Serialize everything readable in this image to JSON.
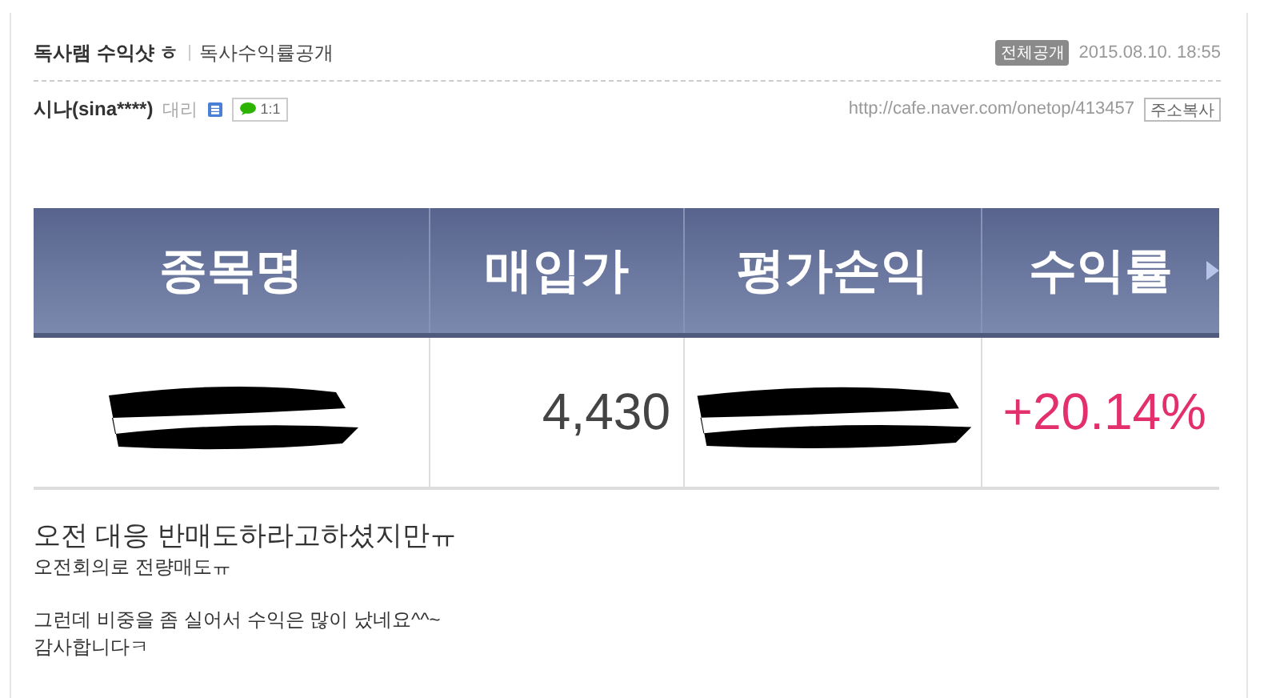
{
  "post": {
    "title": "독사램 수익샷 ㅎ",
    "board": "독사수익률공개",
    "visibility": "전체공개",
    "date": "2015.08.10. 18:55",
    "author": "시나(sina****)",
    "rank": "대리",
    "chat": "1:1",
    "url": "http://cafe.naver.com/onetop/413457",
    "copy_button": "주소복사"
  },
  "table": {
    "columns": [
      "종목명",
      "매입가",
      "평가손익",
      "수익률"
    ],
    "rows": [
      {
        "cells": [
          {
            "kind": "redacted"
          },
          {
            "kind": "number",
            "text": "4,430"
          },
          {
            "kind": "redacted"
          },
          {
            "kind": "rate",
            "text": "+20.14%"
          }
        ]
      }
    ]
  },
  "paragraphs": [
    {
      "lines": [
        {
          "kind": "large",
          "text": "오전 대응 반매도하라고하셨지만ㅠ"
        },
        {
          "kind": "normal",
          "text": "오전회의로 전량매도ㅠ"
        }
      ]
    },
    {
      "lines": [
        {
          "kind": "normal",
          "text": "그런데 비중을 좀 실어서 수익은 많이 났네요^^~"
        },
        {
          "kind": "normal",
          "text": "감사합니다ㅋ"
        }
      ]
    }
  ]
}
